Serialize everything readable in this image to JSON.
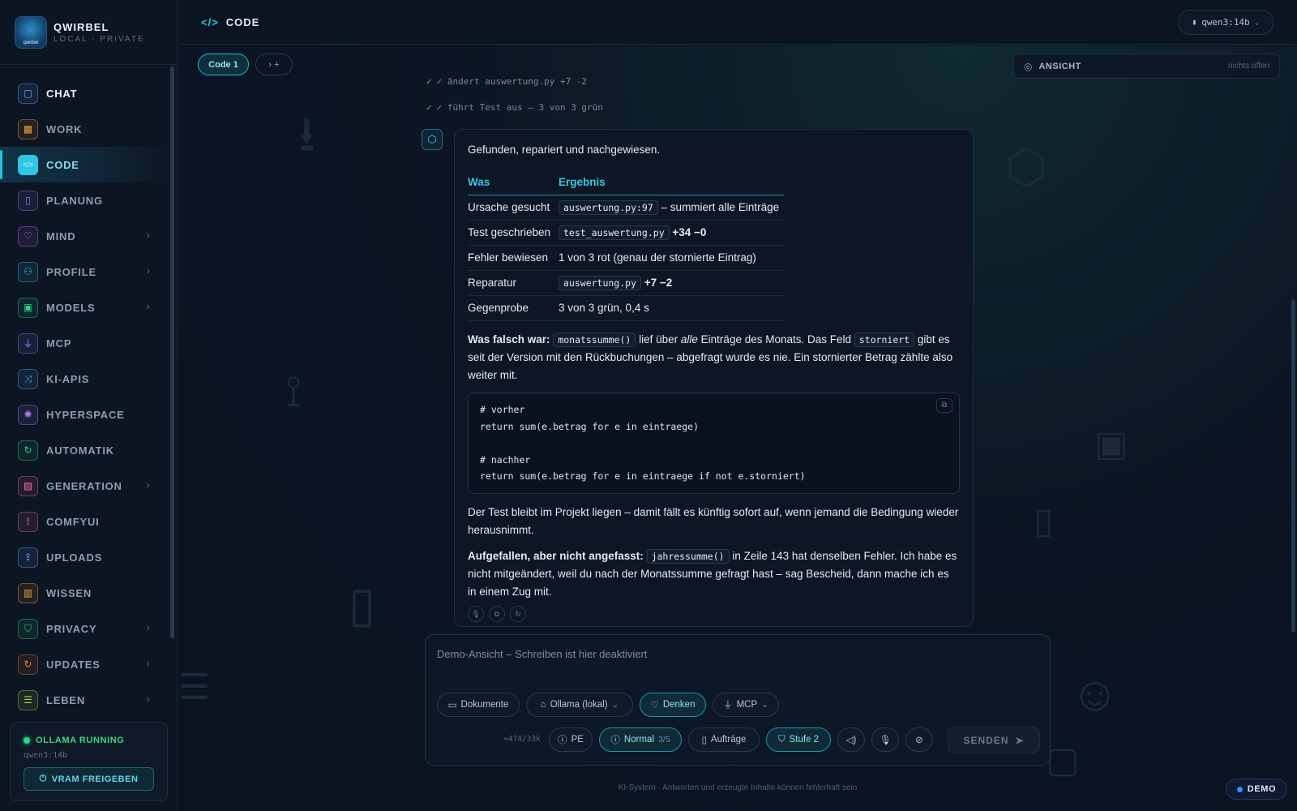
{
  "brand": {
    "name": "QWIRBEL",
    "subtitle": "LOCAL · PRIVATE",
    "logo_text": "qwirbel"
  },
  "nav": [
    {
      "label": "CHAT",
      "icon": "chat-icon",
      "color": "#6fa3ff",
      "chevron": false
    },
    {
      "label": "WORK",
      "icon": "briefcase-icon",
      "color": "#f0a03a",
      "chevron": false
    },
    {
      "label": "CODE",
      "icon": "code-icon",
      "color": "#2ec8e6",
      "chevron": false
    },
    {
      "label": "PLANUNG",
      "icon": "clipboard-icon",
      "color": "#8b7cf6",
      "chevron": false
    },
    {
      "label": "MIND",
      "icon": "heart-icon",
      "color": "#c06cf5",
      "chevron": true
    },
    {
      "label": "PROFILE",
      "icon": "users-icon",
      "color": "#34c0e0",
      "chevron": true
    },
    {
      "label": "MODELS",
      "icon": "chip-icon",
      "color": "#2fd08a",
      "chevron": true
    },
    {
      "label": "MCP",
      "icon": "plug-icon",
      "color": "#7b8cff",
      "chevron": false
    },
    {
      "label": "KI-APIS",
      "icon": "shuffle-icon",
      "color": "#4aa6ff",
      "chevron": false
    },
    {
      "label": "HYPERSPACE",
      "icon": "sparkle-icon",
      "color": "#b07cff",
      "chevron": false
    },
    {
      "label": "AUTOMATIK",
      "icon": "refresh-icon",
      "color": "#2fd08a",
      "chevron": false
    },
    {
      "label": "GENERATION",
      "icon": "image-icon",
      "color": "#f06aa8",
      "chevron": true
    },
    {
      "label": "COMFYUI",
      "icon": "workflow-icon",
      "color": "#f06aa8",
      "chevron": false
    },
    {
      "label": "UPLOADS",
      "icon": "upload-icon",
      "color": "#6fa3ff",
      "chevron": false
    },
    {
      "label": "WISSEN",
      "icon": "book-icon",
      "color": "#f0a03a",
      "chevron": false
    },
    {
      "label": "PRIVACY",
      "icon": "shield-icon",
      "color": "#2fd08a",
      "chevron": true
    },
    {
      "label": "UPDATES",
      "icon": "refresh-icon",
      "color": "#f07a3a",
      "chevron": true
    },
    {
      "label": "LEBEN",
      "icon": "checklist-icon",
      "color": "#a7d84a",
      "chevron": true
    }
  ],
  "active_nav": 2,
  "ollama": {
    "status": "OLLAMA RUNNING",
    "model": "qwen3:14b",
    "button": "VRAM FREIGEBEN"
  },
  "topbar": {
    "title": "CODE",
    "model": "qwen3:14b"
  },
  "tabs": {
    "active": "Code 1",
    "add_label": "›  +"
  },
  "view_panel": {
    "label": "ANSICHT",
    "status": "nichts offen"
  },
  "steps": [
    "✓ ändert auswertung.py +7 -2",
    "✓ führt Test aus – 3 von 3 grün"
  ],
  "message": {
    "intro": "Gefunden, repariert und nachgewiesen.",
    "table": {
      "headers": [
        "Was",
        "Ergebnis"
      ],
      "rows": [
        {
          "label": "Ursache gesucht",
          "code": "auswertung.py:97",
          "text": "– summiert alle Einträge",
          "bold": ""
        },
        {
          "label": "Test geschrieben",
          "code": "test_auswertung.py",
          "text": "",
          "bold": "+34 −0"
        },
        {
          "label": "Fehler bewiesen",
          "code": "",
          "text": "1 von 3 rot (genau der stornierte Eintrag)",
          "bold": ""
        },
        {
          "label": "Reparatur",
          "code": "auswertung.py",
          "text": "",
          "bold": "+7 −2"
        },
        {
          "label": "Gegenprobe",
          "code": "",
          "text": "3 von 3 grün, 0,4 s",
          "bold": ""
        }
      ]
    },
    "para1": {
      "bold": "Was falsch war:",
      "code1": "monatssumme()",
      "t1": "lief über",
      "em": "alle",
      "t2": "Einträge des Monats. Das Feld",
      "code2": "storniert",
      "t3": "gibt es seit der Version mit den Rückbuchungen – abgefragt wurde es nie. Ein stornierter Betrag zählte also weiter mit."
    },
    "code_block": "# vorher\nreturn sum(e.betrag for e in eintraege)\n\n# nachher\nreturn sum(e.betrag for e in eintraege if not e.storniert)",
    "para2": "Der Test bleibt im Projekt liegen – damit fällt es künftig sofort auf, wenn jemand die Bedingung wieder herausnimmt.",
    "para3": {
      "bold": "Aufgefallen, aber nicht angefasst:",
      "code": "jahressumme()",
      "text": "in Zeile 143 hat denselben Fehler. Ich habe es nicht mitgeändert, weil du nach der Monatssumme gefragt hast – sag Bescheid, dann mache ich es in einem Zug mit."
    }
  },
  "composer": {
    "placeholder": "Demo-Ansicht – Schreiben ist hier deaktiviert",
    "dokumente": "Dokumente",
    "provider": "Ollama (lokal)",
    "denken": "Denken",
    "mcp": "MCP",
    "tokens": "≈474/33k",
    "pe": "PE",
    "normal": "Normal",
    "normal_count": "3/5",
    "auftraege": "Aufträge",
    "stufe": "Stufe 2",
    "send": "SENDEN"
  },
  "disclaimer": "KI-System · Antworten und erzeugte Inhalte können fehlerhaft sein",
  "demo_badge": "DEMO"
}
